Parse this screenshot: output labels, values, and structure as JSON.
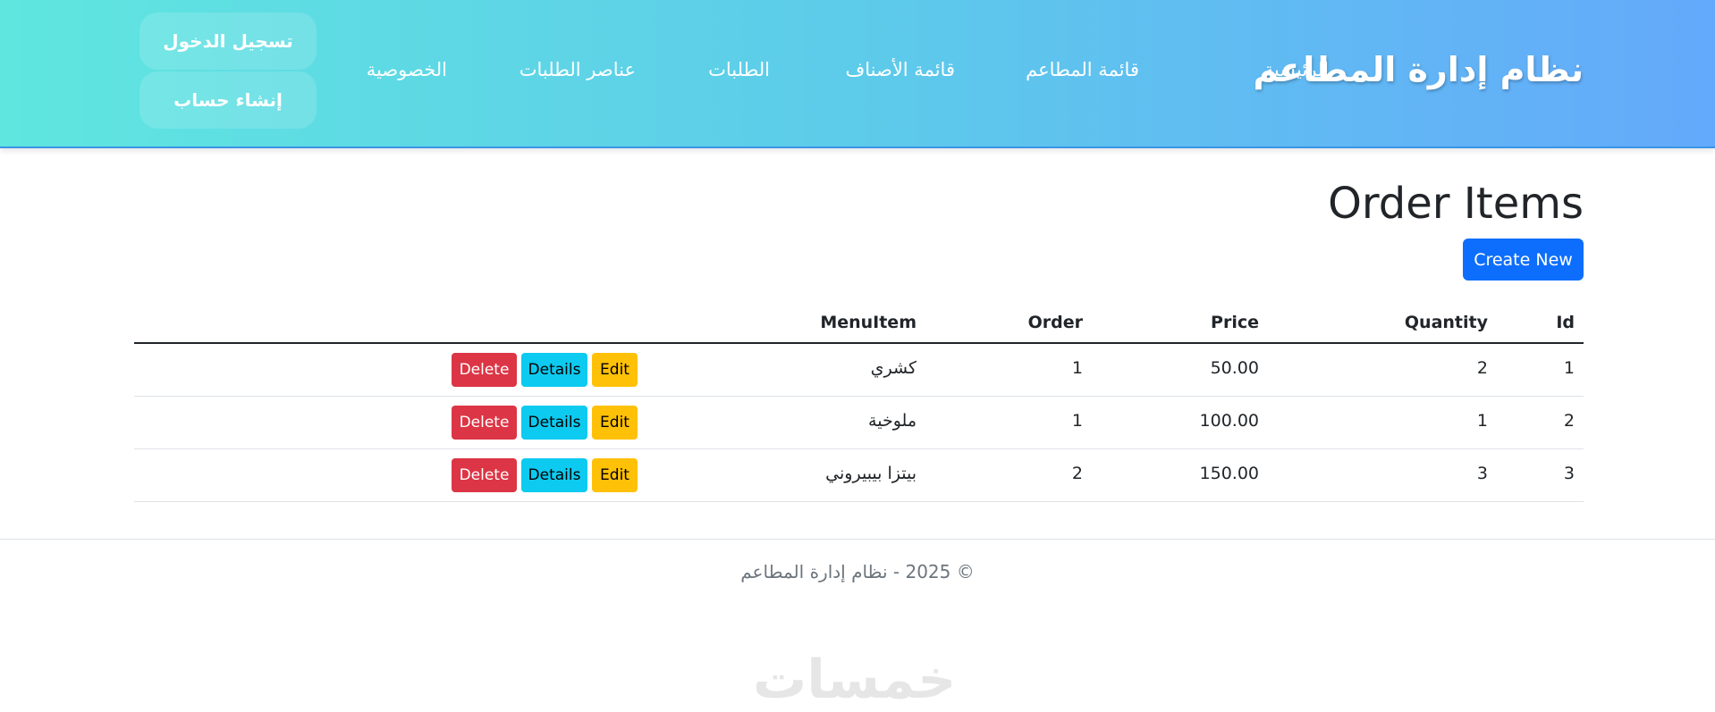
{
  "header": {
    "brand": "نظام إدارة المطاعم",
    "nav": [
      "الرئيسية",
      "قائمة المطاعم",
      "قائمة الأصناف",
      "الطلبات",
      "عناصر الطلبات",
      "الخصوصية"
    ],
    "login_label": "تسجيل الدخول",
    "register_label": "إنشاء حساب"
  },
  "main": {
    "title": "Order Items",
    "create_label": "Create New",
    "columns": {
      "id": "Id",
      "quantity": "Quantity",
      "price": "Price",
      "order": "Order",
      "menuitem": "MenuItem"
    },
    "actions": {
      "edit": "Edit",
      "details": "Details",
      "delete": "Delete"
    },
    "rows": [
      {
        "id": "1",
        "quantity": "2",
        "price": "50.00",
        "order": "1",
        "menuitem": "كشري"
      },
      {
        "id": "2",
        "quantity": "1",
        "price": "100.00",
        "order": "1",
        "menuitem": "ملوخية"
      },
      {
        "id": "3",
        "quantity": "3",
        "price": "150.00",
        "order": "2",
        "menuitem": "بيتزا بيبيروني"
      }
    ]
  },
  "footer": {
    "text": "© 2025 - نظام إدارة المطاعم"
  },
  "watermark": "خمسات",
  "colors": {
    "header_gradient": [
      "#5fe6df",
      "#64a9fb"
    ],
    "primary": "#0d6efd",
    "danger": "#dc3545",
    "info": "#0dcaf0",
    "warning": "#ffc107"
  }
}
